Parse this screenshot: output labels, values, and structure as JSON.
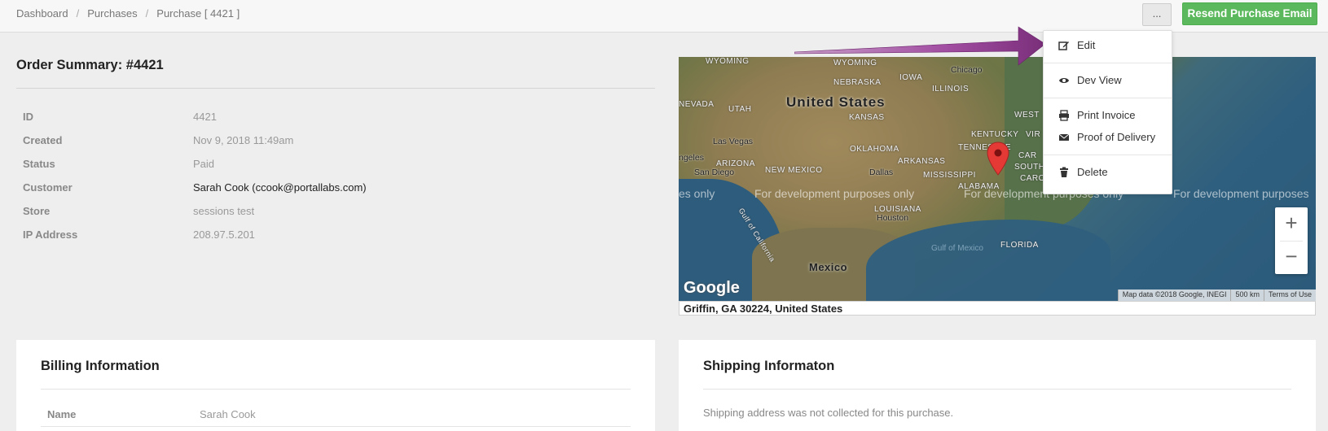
{
  "breadcrumb": {
    "items": [
      "Dashboard",
      "Purchases",
      "Purchase [ 4421 ]"
    ],
    "separator": "/"
  },
  "toolbar": {
    "more_label": "...",
    "resend_label": "Resend Purchase Email"
  },
  "summary": {
    "title": "Order Summary: #4421",
    "rows": [
      {
        "label": "ID",
        "value": "4421"
      },
      {
        "label": "Created",
        "value": "Nov 9, 2018 11:49am"
      },
      {
        "label": "Status",
        "value": "Paid"
      },
      {
        "label": "Customer",
        "value": "Sarah Cook (ccook@portallabs.com)"
      },
      {
        "label": "Store",
        "value": "sessions test"
      },
      {
        "label": "IP Address",
        "value": "208.97.5.201"
      }
    ]
  },
  "map": {
    "country_label": "United States",
    "mexico_label": "Mexico",
    "region_labels": [
      "WYOMING",
      "NEBRASKA",
      "IOWA",
      "ILLINOIS",
      "NEVADA",
      "UTAH",
      "KANSAS",
      "OKLAHOMA",
      "ARKANSAS",
      "ARIZONA",
      "NEW MEXICO",
      "TENNESSEE",
      "KENTUCKY",
      "WEST",
      "VIR",
      "MISSISSIPPI",
      "ALABAMA",
      "LOUISIANA",
      "CAR",
      "SOUTH",
      "CAROL",
      "FLORIDA",
      "Gulf of California"
    ],
    "city_labels": [
      "Chicago",
      "Las Vegas",
      "ngeles",
      "San Diego",
      "Dallas",
      "Houston"
    ],
    "sea_label": "Gulf of Mexico",
    "watermark": "For development purposes only",
    "watermark_clip_left": "es only",
    "watermark_clip_right": "For development purposes",
    "google_label": "Google",
    "attribution": [
      "Map data ©2018 Google, INEGI",
      "500 km",
      "Terms of Use"
    ],
    "zoom_in": "+",
    "zoom_out": "−",
    "caption": "Griffin, GA 30224, United States",
    "pin_color": "#e53935",
    "land_color": "#8d7a52",
    "water_color": "#2f5f7e"
  },
  "billing": {
    "title": "Billing Information",
    "rows": [
      {
        "label": "Name",
        "value": "Sarah Cook"
      }
    ]
  },
  "shipping": {
    "title": "Shipping Informaton",
    "note": "Shipping address was not collected for this purchase."
  },
  "dropdown": {
    "items": [
      {
        "label": "Edit",
        "icon": "edit-icon"
      },
      {
        "label": "Dev View",
        "icon": "eye-icon"
      },
      {
        "label": "Print Invoice",
        "icon": "printer-icon"
      },
      {
        "label": "Proof of Delivery",
        "icon": "envelope-icon"
      },
      {
        "label": "Delete",
        "icon": "trash-icon"
      }
    ]
  },
  "colors": {
    "accent_green": "#5cb85c",
    "arrow_purple": "#8e3a8e"
  }
}
